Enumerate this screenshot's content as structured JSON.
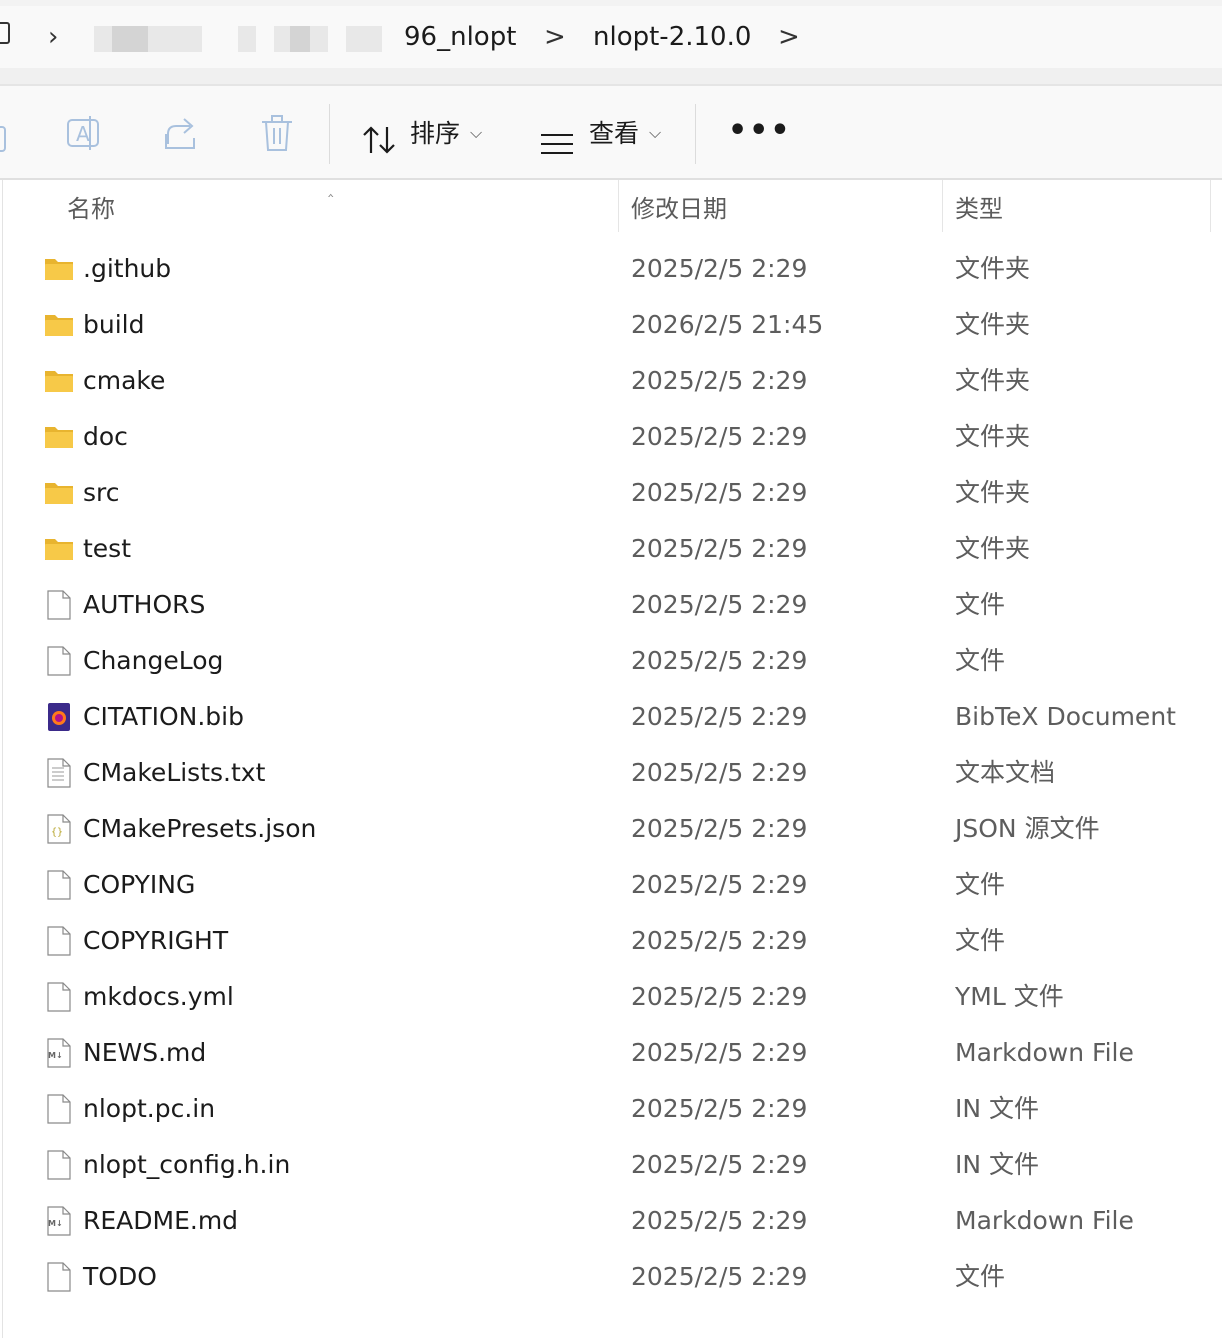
{
  "address_bar": {
    "crumbs": [
      "96_nlopt",
      "nlopt-2.10.0"
    ],
    "separator": ">"
  },
  "toolbar": {
    "sort_label": "排序",
    "view_label": "查看",
    "more_label": "•••"
  },
  "columns": {
    "name": "名称",
    "modified": "修改日期",
    "type": "类型"
  },
  "files": [
    {
      "name": ".github",
      "modified": "2025/2/5 2:29",
      "type": "文件夹",
      "icon": "folder-icon"
    },
    {
      "name": "build",
      "modified": "2026/2/5 21:45",
      "type": "文件夹",
      "icon": "folder-icon"
    },
    {
      "name": "cmake",
      "modified": "2025/2/5 2:29",
      "type": "文件夹",
      "icon": "folder-icon"
    },
    {
      "name": "doc",
      "modified": "2025/2/5 2:29",
      "type": "文件夹",
      "icon": "folder-icon"
    },
    {
      "name": "src",
      "modified": "2025/2/5 2:29",
      "type": "文件夹",
      "icon": "folder-icon"
    },
    {
      "name": "test",
      "modified": "2025/2/5 2:29",
      "type": "文件夹",
      "icon": "folder-icon"
    },
    {
      "name": "AUTHORS",
      "modified": "2025/2/5 2:29",
      "type": "文件",
      "icon": "file-icon"
    },
    {
      "name": "ChangeLog",
      "modified": "2025/2/5 2:29",
      "type": "文件",
      "icon": "file-icon"
    },
    {
      "name": "CITATION.bib",
      "modified": "2025/2/5 2:29",
      "type": "BibTeX Document",
      "icon": "bibtex-file-icon"
    },
    {
      "name": "CMakeLists.txt",
      "modified": "2025/2/5 2:29",
      "type": "文本文档",
      "icon": "text-file-icon"
    },
    {
      "name": "CMakePresets.json",
      "modified": "2025/2/5 2:29",
      "type": "JSON 源文件",
      "icon": "json-file-icon"
    },
    {
      "name": "COPYING",
      "modified": "2025/2/5 2:29",
      "type": "文件",
      "icon": "file-icon"
    },
    {
      "name": "COPYRIGHT",
      "modified": "2025/2/5 2:29",
      "type": "文件",
      "icon": "file-icon"
    },
    {
      "name": "mkdocs.yml",
      "modified": "2025/2/5 2:29",
      "type": "YML 文件",
      "icon": "file-icon"
    },
    {
      "name": "NEWS.md",
      "modified": "2025/2/5 2:29",
      "type": "Markdown File",
      "icon": "markdown-file-icon"
    },
    {
      "name": "nlopt.pc.in",
      "modified": "2025/2/5 2:29",
      "type": "IN 文件",
      "icon": "file-icon"
    },
    {
      "name": "nlopt_config.h.in",
      "modified": "2025/2/5 2:29",
      "type": "IN 文件",
      "icon": "file-icon"
    },
    {
      "name": "README.md",
      "modified": "2025/2/5 2:29",
      "type": "Markdown File",
      "icon": "markdown-file-icon"
    },
    {
      "name": "TODO",
      "modified": "2025/2/5 2:29",
      "type": "文件",
      "icon": "file-icon"
    }
  ],
  "colors": {
    "folder": "#f7c948",
    "folder_tab": "#e8b42f",
    "text_secondary": "#5d5d5d",
    "toolbar_icon_disabled": "#a9c1de"
  }
}
